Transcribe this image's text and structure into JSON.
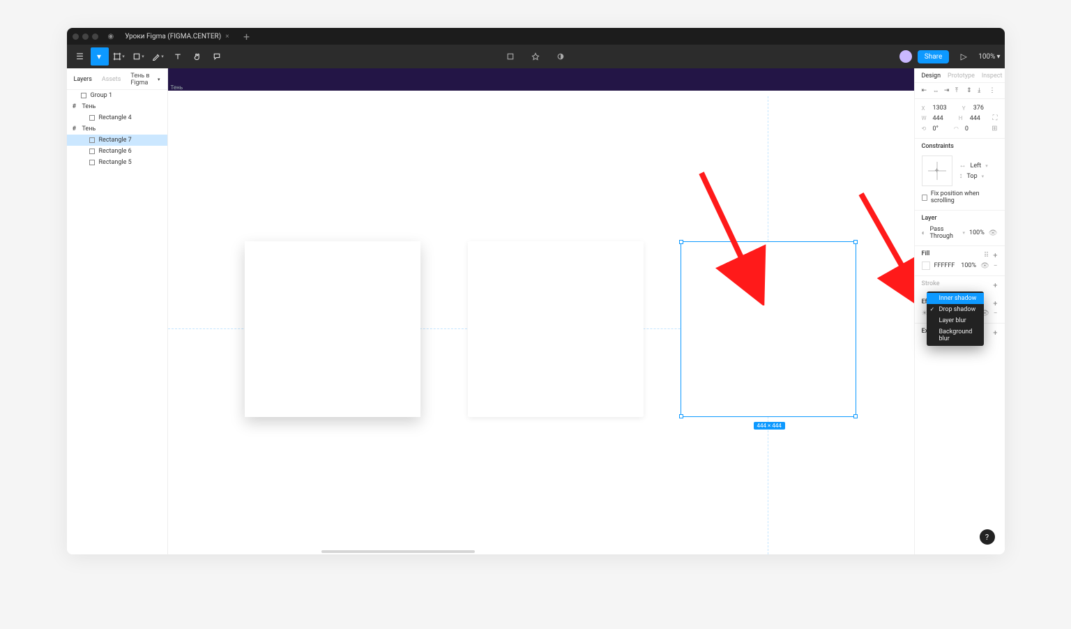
{
  "titlebar": {
    "tab_title": "Уроки Figma (FIGMA.CENTER)"
  },
  "toolbar": {
    "share_label": "Share",
    "zoom": "100%"
  },
  "left_panel": {
    "tabs": {
      "layers": "Layers",
      "assets": "Assets"
    },
    "page_label": "Тень в Figma",
    "layers": [
      {
        "name": "Group 1",
        "type": "group",
        "indent": 1,
        "sel": false
      },
      {
        "name": "Тень",
        "type": "frame",
        "indent": 0,
        "sel": false
      },
      {
        "name": "Rectangle 4",
        "type": "rect",
        "indent": 2,
        "sel": false
      },
      {
        "name": "Тень",
        "type": "frame",
        "indent": 0,
        "sel": false
      },
      {
        "name": "Rectangle 7",
        "type": "rect",
        "indent": 2,
        "sel": true
      },
      {
        "name": "Rectangle 6",
        "type": "rect",
        "indent": 2,
        "sel": false
      },
      {
        "name": "Rectangle 5",
        "type": "rect",
        "indent": 2,
        "sel": false
      }
    ]
  },
  "canvas": {
    "frame_label": "Тень",
    "dim_badge": "444 × 444"
  },
  "right_panel": {
    "tabs": {
      "design": "Design",
      "prototype": "Prototype",
      "inspect": "Inspect"
    },
    "position": {
      "x": "1303",
      "y": "376",
      "w": "444",
      "h": "444",
      "rot": "0°",
      "radius": "0"
    },
    "constraints": {
      "title": "Constraints",
      "h": "Left",
      "v": "Top",
      "fix_scroll": "Fix position when scrolling"
    },
    "layer": {
      "title": "Layer",
      "blend": "Pass Through",
      "opacity": "100%"
    },
    "fill": {
      "title": "Fill",
      "hex": "FFFFFF",
      "opacity": "100%"
    },
    "effects": {
      "title": "Effects"
    },
    "export": {
      "title": "Export"
    }
  },
  "fx_menu": {
    "items": [
      {
        "label": "Inner shadow",
        "highlight": true,
        "check": false
      },
      {
        "label": "Drop shadow",
        "highlight": false,
        "check": true
      },
      {
        "label": "Layer blur",
        "highlight": false,
        "check": false
      },
      {
        "label": "Background blur",
        "highlight": false,
        "check": false
      }
    ]
  },
  "help_label": "?"
}
